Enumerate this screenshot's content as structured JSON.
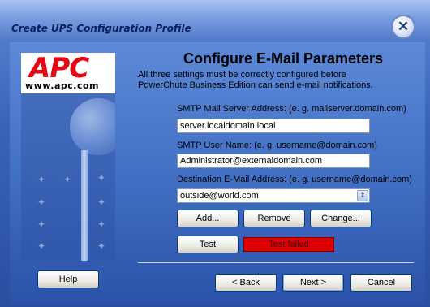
{
  "window": {
    "title": "Create UPS Configuration Profile",
    "close_symbol": "✕",
    "close_icon": "close-icon"
  },
  "logo": {
    "brand": "APC",
    "url": "www.apc.com"
  },
  "page": {
    "heading": "Configure E-Mail Parameters",
    "intro": "All three settings must be correctly configured before PowerChute Business Edition can send e-mail notifications."
  },
  "form": {
    "smtp_server_label": "SMTP Mail Server Address:  (e. g. mailserver.domain.com)",
    "smtp_server_value": "server.localdomain.local",
    "smtp_user_label": "SMTP User Name:  (e. g. username@domain.com)",
    "smtp_user_value": "Administrator@externaldomain.com",
    "dest_label": "Destination E-Mail Address:  (e. g. username@domain.com)",
    "dest_value": "outside@world.com",
    "dropdown_icon": "chevron-updown-icon"
  },
  "buttons": {
    "add": "Add...",
    "remove": "Remove",
    "change": "Change...",
    "test": "Test",
    "help": "Help",
    "back": "< Back",
    "next": "Next >",
    "cancel": "Cancel"
  },
  "test_status": {
    "text": "Test failed",
    "color": "#e10000"
  },
  "colors": {
    "accent": "#3a64b8",
    "title_text": "#0b1f5c",
    "brand_red": "#e30613"
  }
}
